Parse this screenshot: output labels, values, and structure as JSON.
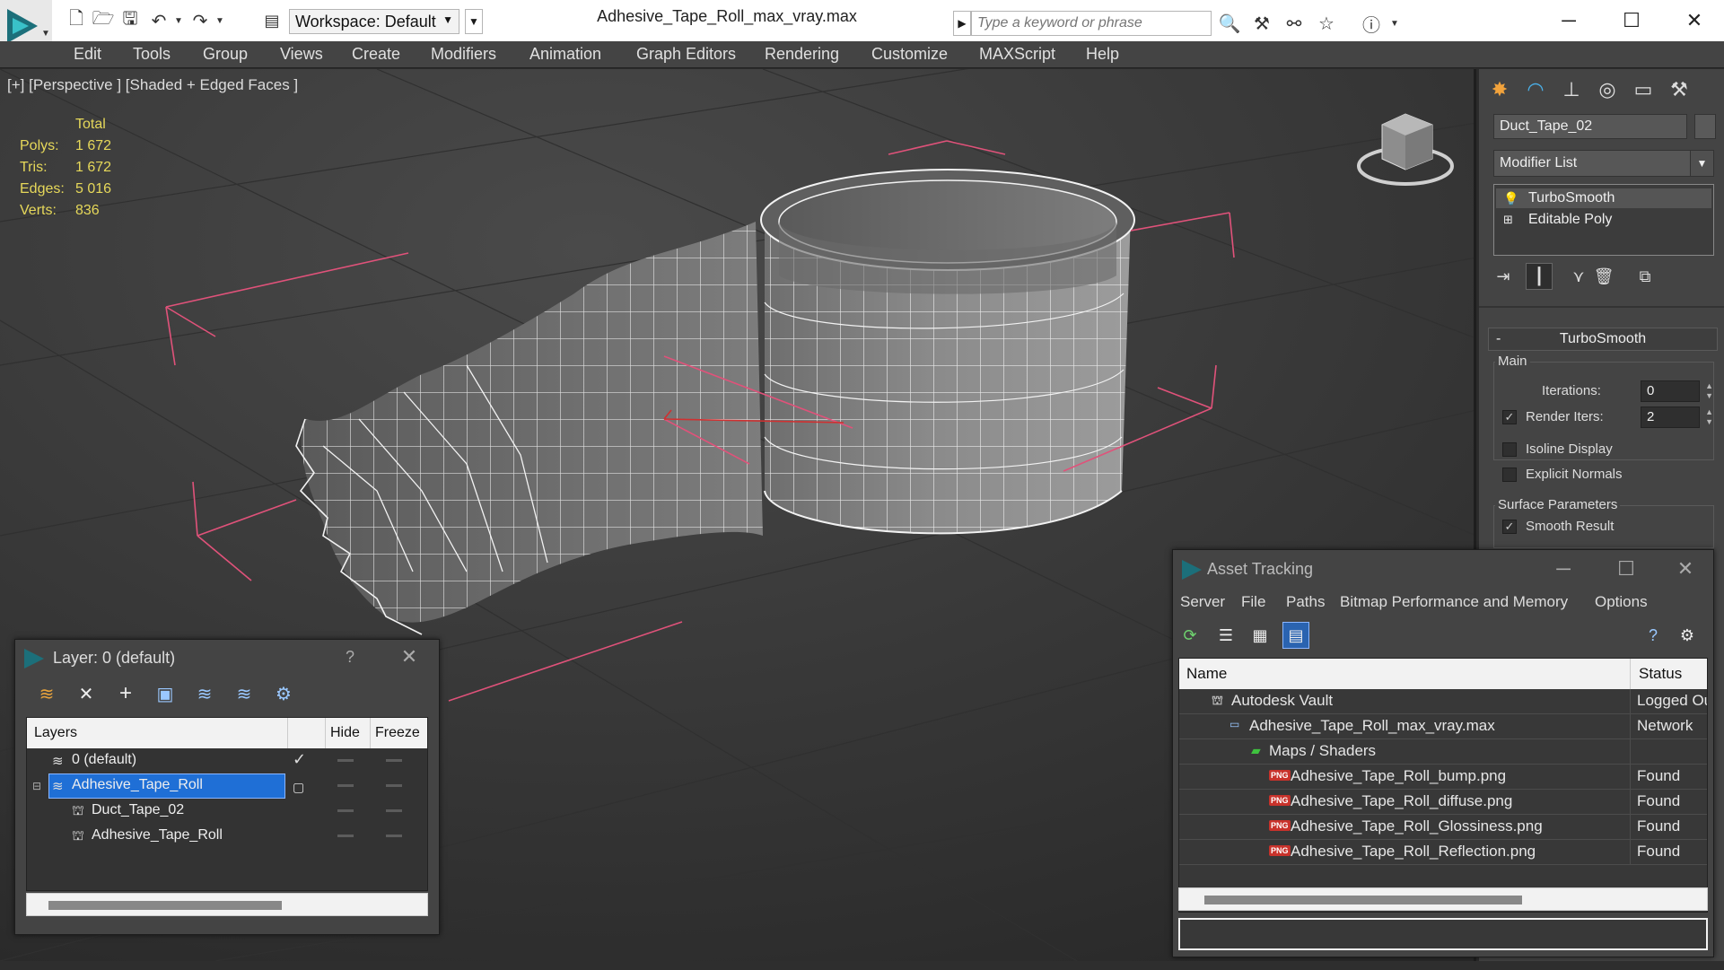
{
  "titlebar": {
    "workspace_label": "Workspace: Default",
    "document_title": "Adhesive_Tape_Roll_max_vray.max",
    "search_placeholder": "Type a keyword or phrase",
    "minimize": "─",
    "maximize": "☐",
    "close": "✕"
  },
  "menu": [
    "Edit",
    "Tools",
    "Group",
    "Views",
    "Create",
    "Modifiers",
    "Animation",
    "Graph Editors",
    "Rendering",
    "Customize",
    "MAXScript",
    "Help"
  ],
  "viewport": {
    "label": "[+] [Perspective ] [Shaded + Edged Faces ]",
    "stats_header": "Total",
    "stats": [
      {
        "label": "Polys:",
        "value": "1 672"
      },
      {
        "label": "Tris:",
        "value": "1 672"
      },
      {
        "label": "Edges:",
        "value": "5 016"
      },
      {
        "label": "Verts:",
        "value": "836"
      }
    ]
  },
  "command_panel": {
    "object_name": "Duct_Tape_02",
    "modifier_list": "Modifier List",
    "stack": [
      "TurboSmooth",
      "Editable Poly"
    ],
    "rollout_title": "TurboSmooth",
    "main_group": "Main",
    "iterations_label": "Iterations:",
    "iterations_value": "0",
    "render_iters_label": "Render Iters:",
    "render_iters_value": "2",
    "render_iters_checked": true,
    "isoline_label": "Isoline Display",
    "explicit_normals_label": "Explicit Normals",
    "surface_group": "Surface Parameters",
    "smooth_result_label": "Smooth Result",
    "smooth_result_checked": true
  },
  "layer_window": {
    "title": "Layer: 0 (default)",
    "help": "?",
    "close": "✕",
    "columns": {
      "layers": "Layers",
      "hide": "Hide",
      "freeze": "Freeze"
    },
    "rows": [
      {
        "name": "0 (default)",
        "type": "layer",
        "current": true,
        "selected": false,
        "indent": 0
      },
      {
        "name": "Adhesive_Tape_Roll",
        "type": "layer",
        "current": false,
        "selected": true,
        "indent": 0
      },
      {
        "name": "Duct_Tape_02",
        "type": "object",
        "current": false,
        "selected": false,
        "indent": 1
      },
      {
        "name": "Adhesive_Tape_Roll",
        "type": "object",
        "current": false,
        "selected": false,
        "indent": 1
      }
    ]
  },
  "asset_window": {
    "title": "Asset Tracking",
    "minimize": "─",
    "maximize": "☐",
    "close": "✕",
    "menu": [
      "Server",
      "File",
      "Paths",
      "Bitmap Performance and Memory",
      "Options"
    ],
    "columns": {
      "name": "Name",
      "status": "Status"
    },
    "rows": [
      {
        "name": "Autodesk Vault",
        "status": "Logged Out",
        "indent": 0,
        "icon": "vault-icon"
      },
      {
        "name": "Adhesive_Tape_Roll_max_vray.max",
        "status": "Network",
        "indent": 1,
        "icon": "max-file-icon"
      },
      {
        "name": "Maps / Shaders",
        "status": "",
        "indent": 2,
        "icon": "maps-folder-icon"
      },
      {
        "name": "Adhesive_Tape_Roll_bump.png",
        "status": "Found",
        "indent": 3,
        "icon": "png-icon"
      },
      {
        "name": "Adhesive_Tape_Roll_diffuse.png",
        "status": "Found",
        "indent": 3,
        "icon": "png-icon"
      },
      {
        "name": "Adhesive_Tape_Roll_Glossiness.png",
        "status": "Found",
        "indent": 3,
        "icon": "png-icon"
      },
      {
        "name": "Adhesive_Tape_Roll_Reflection.png",
        "status": "Found",
        "indent": 3,
        "icon": "png-icon"
      }
    ]
  },
  "colors": {
    "stats": "#e6d85a",
    "selection": "#1f6fd6",
    "bbox": "#e0527a",
    "app_teal": "#1c6f7a"
  }
}
